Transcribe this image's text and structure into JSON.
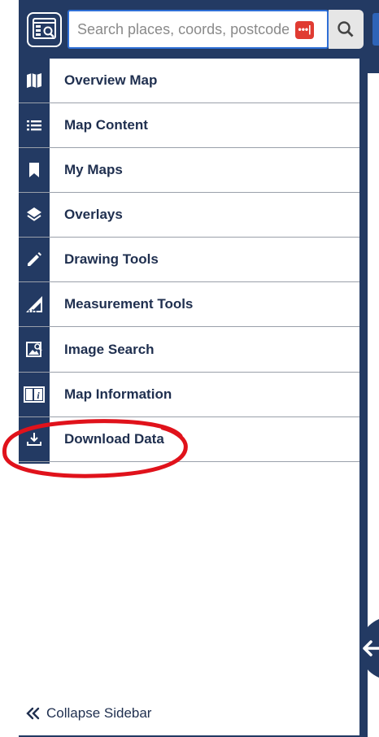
{
  "search": {
    "placeholder": "Search places, coords, postcodes"
  },
  "password_badge": "•••|",
  "menu": [
    {
      "label": "Overview Map",
      "icon": "map-icon"
    },
    {
      "label": "Map Content",
      "icon": "list-icon"
    },
    {
      "label": "My Maps",
      "icon": "bookmark-icon"
    },
    {
      "label": "Overlays",
      "icon": "layers-icon"
    },
    {
      "label": "Drawing Tools",
      "icon": "pencil-icon"
    },
    {
      "label": "Measurement Tools",
      "icon": "ruler-triangle-icon"
    },
    {
      "label": "Image Search",
      "icon": "image-search-icon"
    },
    {
      "label": "Map Information",
      "icon": "info-icon"
    },
    {
      "label": "Download Data",
      "icon": "download-icon"
    }
  ],
  "collapse": {
    "label": "Collapse Sidebar"
  },
  "colors": {
    "sidebar": "#233a63",
    "highlight_ring": "#e0121b",
    "search_border": "#2f6fd6"
  }
}
